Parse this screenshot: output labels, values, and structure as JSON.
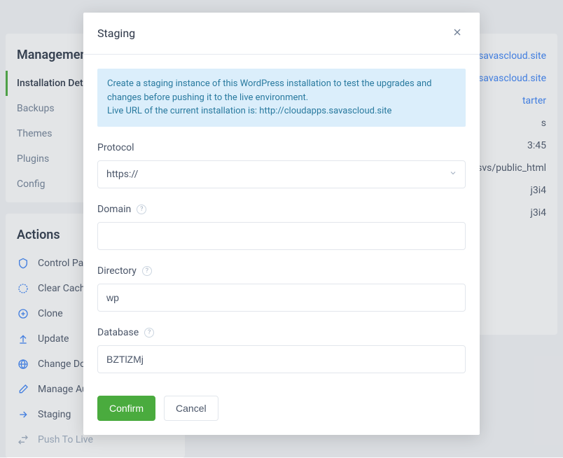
{
  "sidebar": {
    "management_header": "Management",
    "nav": [
      {
        "label": "Installation Details",
        "active": true
      },
      {
        "label": "Backups"
      },
      {
        "label": "Themes"
      },
      {
        "label": "Plugins"
      },
      {
        "label": "Config"
      }
    ],
    "actions_header": "Actions",
    "actions": [
      {
        "label": "Control Panel",
        "icon": "shield-icon"
      },
      {
        "label": "Clear Cache",
        "icon": "refresh-icon"
      },
      {
        "label": "Clone",
        "icon": "circle-plus-icon"
      },
      {
        "label": "Update",
        "icon": "upload-icon"
      },
      {
        "label": "Change Domain",
        "icon": "globe-icon"
      },
      {
        "label": "Manage Auto",
        "icon": "pencil-icon"
      },
      {
        "label": "Staging",
        "icon": "arrow-right-icon"
      },
      {
        "label": "Push To Live",
        "icon": "swap-icon",
        "disabled": true
      }
    ]
  },
  "content": {
    "rows": [
      {
        "link": "savascloud.site"
      },
      {
        "link": "ps.savascloud.site"
      },
      {
        "link": "tarter"
      },
      {
        "text": "s"
      },
      {
        "text": "3:45"
      },
      {
        "text": "osvs/public_html"
      },
      {
        "text": "j3i4"
      },
      {
        "text": "j3i4"
      }
    ]
  },
  "modal": {
    "title": "Staging",
    "info": "Create a staging instance of this WordPress installation to test the upgrades and changes before pushing it to the live environment.\nLive URL of the current installation is: http://cloudapps.savascloud.site",
    "fields": {
      "protocol": {
        "label": "Protocol",
        "value": "https://"
      },
      "domain": {
        "label": "Domain",
        "value": ""
      },
      "directory": {
        "label": "Directory",
        "value": "wp"
      },
      "database": {
        "label": "Database",
        "value": "BZTlZMj"
      }
    },
    "buttons": {
      "confirm": "Confirm",
      "cancel": "Cancel"
    }
  }
}
